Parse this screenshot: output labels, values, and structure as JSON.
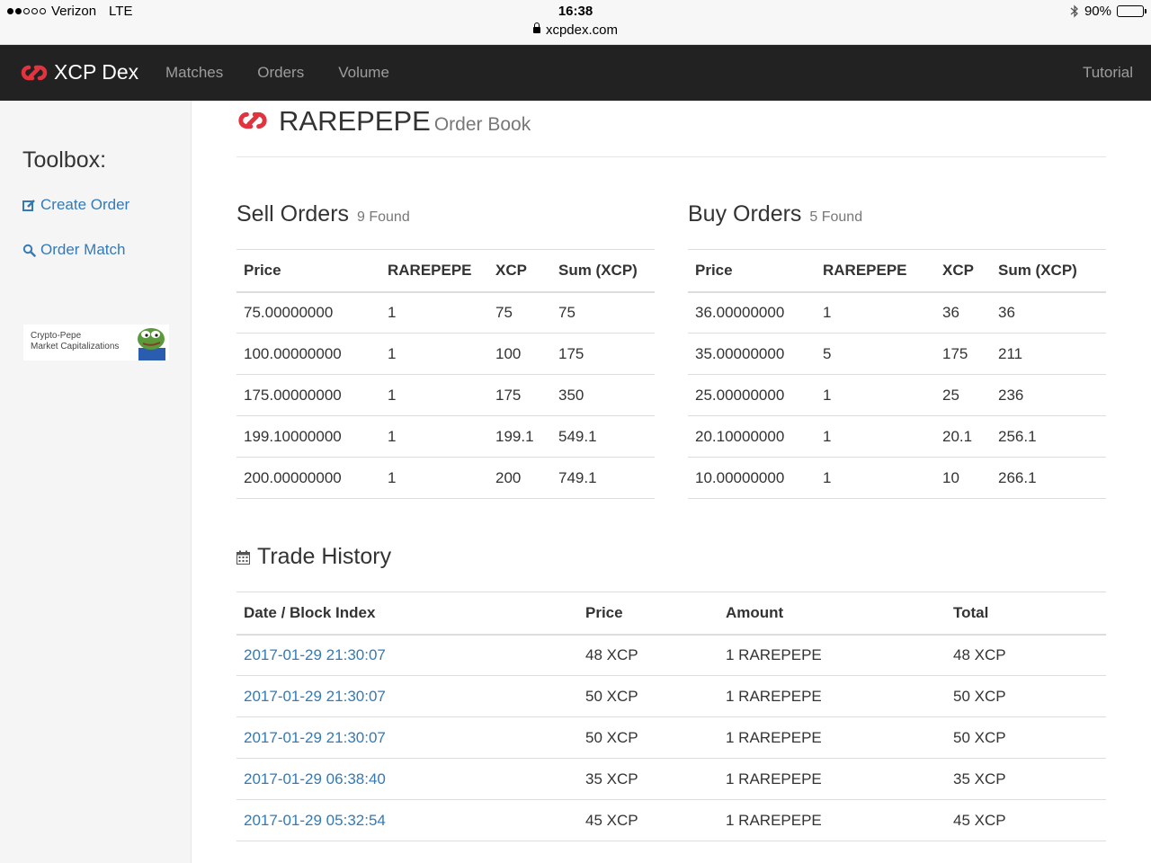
{
  "status_bar": {
    "carrier": "Verizon",
    "network": "LTE",
    "time": "16:38",
    "url": "xcpdex.com",
    "battery": "90%",
    "battery_level": 0.9
  },
  "navbar": {
    "brand": "XCP Dex",
    "links": [
      "Matches",
      "Orders",
      "Volume"
    ],
    "right_link": "Tutorial"
  },
  "sidebar": {
    "title": "Toolbox:",
    "create_order": "Create Order",
    "order_match": "Order Match",
    "banner_line1": "Crypto-Pepe",
    "banner_line2": "Market Capitalizations"
  },
  "header": {
    "asset": "RAREPEPE",
    "subtitle": "Order Book"
  },
  "sell_orders": {
    "title": "Sell Orders",
    "found": "9 Found",
    "columns": [
      "Price",
      "RAREPEPE",
      "XCP",
      "Sum (XCP)"
    ],
    "rows": [
      [
        "75.00000000",
        "1",
        "75",
        "75"
      ],
      [
        "100.00000000",
        "1",
        "100",
        "175"
      ],
      [
        "175.00000000",
        "1",
        "175",
        "350"
      ],
      [
        "199.10000000",
        "1",
        "199.1",
        "549.1"
      ],
      [
        "200.00000000",
        "1",
        "200",
        "749.1"
      ]
    ]
  },
  "buy_orders": {
    "title": "Buy Orders",
    "found": "5 Found",
    "columns": [
      "Price",
      "RAREPEPE",
      "XCP",
      "Sum (XCP)"
    ],
    "rows": [
      [
        "36.00000000",
        "1",
        "36",
        "36"
      ],
      [
        "35.00000000",
        "5",
        "175",
        "211"
      ],
      [
        "25.00000000",
        "1",
        "25",
        "236"
      ],
      [
        "20.10000000",
        "1",
        "20.1",
        "256.1"
      ],
      [
        "10.00000000",
        "1",
        "10",
        "266.1"
      ]
    ]
  },
  "trade_history": {
    "title": "Trade History",
    "columns": [
      "Date / Block Index",
      "Price",
      "Amount",
      "Total"
    ],
    "rows": [
      [
        "2017-01-29 21:30:07",
        "48 XCP",
        "1 RAREPEPE",
        "48 XCP"
      ],
      [
        "2017-01-29 21:30:07",
        "50 XCP",
        "1 RAREPEPE",
        "50 XCP"
      ],
      [
        "2017-01-29 21:30:07",
        "50 XCP",
        "1 RAREPEPE",
        "50 XCP"
      ],
      [
        "2017-01-29 06:38:40",
        "35 XCP",
        "1 RAREPEPE",
        "35 XCP"
      ],
      [
        "2017-01-29 05:32:54",
        "45 XCP",
        "1 RAREPEPE",
        "45 XCP"
      ]
    ]
  },
  "colors": {
    "navbar_bg": "#222222",
    "brand_red": "#e2343f",
    "link_blue": "#337ab7",
    "sidebar_bg": "#f5f5f5"
  }
}
